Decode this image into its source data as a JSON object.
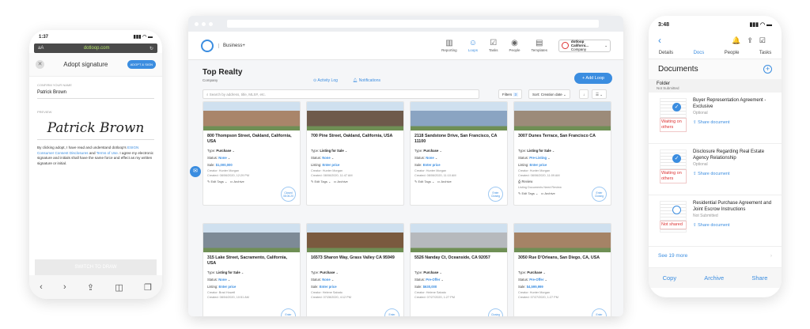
{
  "left_phone": {
    "time": "1:37",
    "carrier": "dotloop",
    "signal": "▮▮▮ ◠ ▬",
    "url_left": "aA",
    "url": "dotloop.com",
    "title": "Adopt signature",
    "adopt_button": "ADOPT & SIGN",
    "name_label": "CONFIRM YOUR NAME",
    "name_value": "Patrick Brown",
    "preview_label": "PREVIEW",
    "signature": "Patrick Brown",
    "legal_1": "By clicking adopt, I have read and understand dotloop's ",
    "legal_link_1": "ESIGN Consumer Consent Disclosures",
    "legal_2": " and ",
    "legal_link_2": "Terms of Use",
    "legal_3": ". I agree my electronic signature and initials shall have the same force and effect as my written signature or initial.",
    "switch_draw": "SWITCH TO DRAW",
    "toolbar": [
      "‹",
      "›",
      "⇪",
      "◫",
      "❐"
    ]
  },
  "desktop": {
    "brand": "Business+",
    "nav": [
      {
        "label": "Reporting",
        "icon": "▥"
      },
      {
        "label": "Loops",
        "icon": "☺"
      },
      {
        "label": "Tasks",
        "icon": "☑"
      },
      {
        "label": "People",
        "icon": "◉"
      },
      {
        "label": "Templates",
        "icon": "▤"
      }
    ],
    "account": {
      "name": "dotloop Californi...",
      "sub": "Company"
    },
    "title": "Top Realty",
    "company": "Company",
    "activity": "Activity Log",
    "notifications": "Notifications",
    "add_loop": "+ Add Loop",
    "search_placeholder": "Search by address, title, MLS#, etc.",
    "filters": "Filters",
    "filter_count": "3",
    "sort": "Sort: Creation date",
    "view": "☰",
    "cards": [
      {
        "address": "800 Thompson Street, Oakland, California, USA",
        "type_label": "Type:",
        "type": "Purchase",
        "status_label": "Status:",
        "status": "None",
        "price_label": "Sale:",
        "price": "$1,000,000",
        "creator": "Creator: Hunter Morgan",
        "created": "Created: 08/06/2020, 12:29 PM",
        "extra": "",
        "tags": "Edit Tags",
        "archive": "Archive",
        "badge": "Closed 08.06.20",
        "photo": "#a9856a"
      },
      {
        "address": "700 Pine Street, Oakland, California, USA",
        "type_label": "Type:",
        "type": "Listing for Sale",
        "status_label": "Status:",
        "status": "None",
        "price_label": "Listing:",
        "price": "Enter price",
        "creator": "Creator: Hunter Morgan",
        "created": "Created: 08/06/2020, 11:47 AM",
        "extra": "",
        "tags": "Edit Tags",
        "archive": "Archive",
        "badge": "",
        "photo": "#6e5a4b"
      },
      {
        "address": "2118 Sandstone Drive, San Francisco, CA 11100",
        "type_label": "Type:",
        "type": "Purchase",
        "status_label": "Status:",
        "status": "None",
        "price_label": "Sale:",
        "price": "Enter price",
        "creator": "Creator: Hunter Morgan",
        "created": "Created: 08/06/2020, 11:10 AM",
        "extra": "",
        "tags": "Edit Tags",
        "archive": "Archive",
        "badge": "Enter Closing",
        "photo": "#8aa4c2"
      },
      {
        "address": "3007 Dunes Terrace, San Francisco CA",
        "type_label": "Type:",
        "type": "Listing for Sale",
        "status_label": "Status:",
        "status": "Pre-Listing",
        "price_label": "Listing:",
        "price": "Enter price",
        "creator": "Creator: Hunter Morgan",
        "created": "Created: 08/06/2020, 11:09 AM",
        "extra": "Review",
        "extra2": "Listing Documents Need Review",
        "tags": "Edit Tags",
        "archive": "Archive",
        "badge": "Enter Closing",
        "photo": "#9c8b79"
      },
      {
        "address": "315 Lake Street, Sacramento, California, USA",
        "type_label": "Type:",
        "type": "Listing for Sale",
        "status_label": "Status:",
        "status": "None",
        "price_label": "Listing:",
        "price": "Enter price",
        "creator": "Creator: Brad Howell",
        "created": "Created: 08/04/2020, 10:51 AM",
        "extra": "",
        "tags": "",
        "archive": "",
        "badge": "Enter",
        "photo": "#7d8a96"
      },
      {
        "address": "16573 Sharon Way, Grass Valley CA 95949",
        "type_label": "Type:",
        "type": "Purchase",
        "status_label": "Status:",
        "status": "None",
        "price_label": "Sale:",
        "price": "Enter price",
        "creator": "Creator: Helene Sabato",
        "created": "Created: 07/28/2020, 4:12 PM",
        "extra": "",
        "tags": "",
        "archive": "",
        "badge": "Enter",
        "photo": "#7a5a3f"
      },
      {
        "address": "5526 Nanday Ct, Oceanside, CA 92057",
        "type_label": "Type:",
        "type": "Purchase",
        "status_label": "Status:",
        "status": "Pre-Offer",
        "price_label": "Sale:",
        "price": "$630,000",
        "creator": "Creator: Helene Sabato",
        "created": "Created: 07/27/2020, 1:27 PM",
        "extra": "",
        "tags": "",
        "archive": "",
        "badge": "Closing",
        "photo": "#b6b9bd"
      },
      {
        "address": "3050 Rue D'Orleans, San Diego, CA, USA",
        "type_label": "Type:",
        "type": "Purchase",
        "status_label": "Status:",
        "status": "Pre-Offer",
        "price_label": "Sale:",
        "price": "$4,599,999",
        "creator": "Creator: Hunter Morgan",
        "created": "Created: 07/27/2020, 1:27 PM",
        "extra": "",
        "tags": "",
        "archive": "",
        "badge": "Enter",
        "photo": "#a58366"
      }
    ]
  },
  "right_phone": {
    "time": "3:48",
    "signal": "▮▮▮ ◠ ▬",
    "back": "‹",
    "icons": [
      "🔔",
      "⇪",
      "☑"
    ],
    "tabs": [
      "Details",
      "Docs",
      "People",
      "Tasks"
    ],
    "section": "Documents",
    "folder": "Folder",
    "folder_status": "Not Submitted",
    "docs": [
      {
        "title": "Buyer Representation Agreement - Exclusive",
        "sub": "Optional",
        "state": "Waiting on others",
        "share": "Share document",
        "done": true
      },
      {
        "title": "Disclosure Regarding Real Estate Agency Relationship",
        "sub": "Optional",
        "state": "Waiting on others",
        "share": "Share document",
        "done": true
      },
      {
        "title": "Residential Purchase Agreement and Joint Escrow Instructions",
        "sub": "Not Submitted",
        "state": "Not shared",
        "share": "Share document",
        "done": false
      }
    ],
    "see_more": "See 19 more",
    "footer": [
      "Copy",
      "Archive",
      "Share"
    ]
  }
}
